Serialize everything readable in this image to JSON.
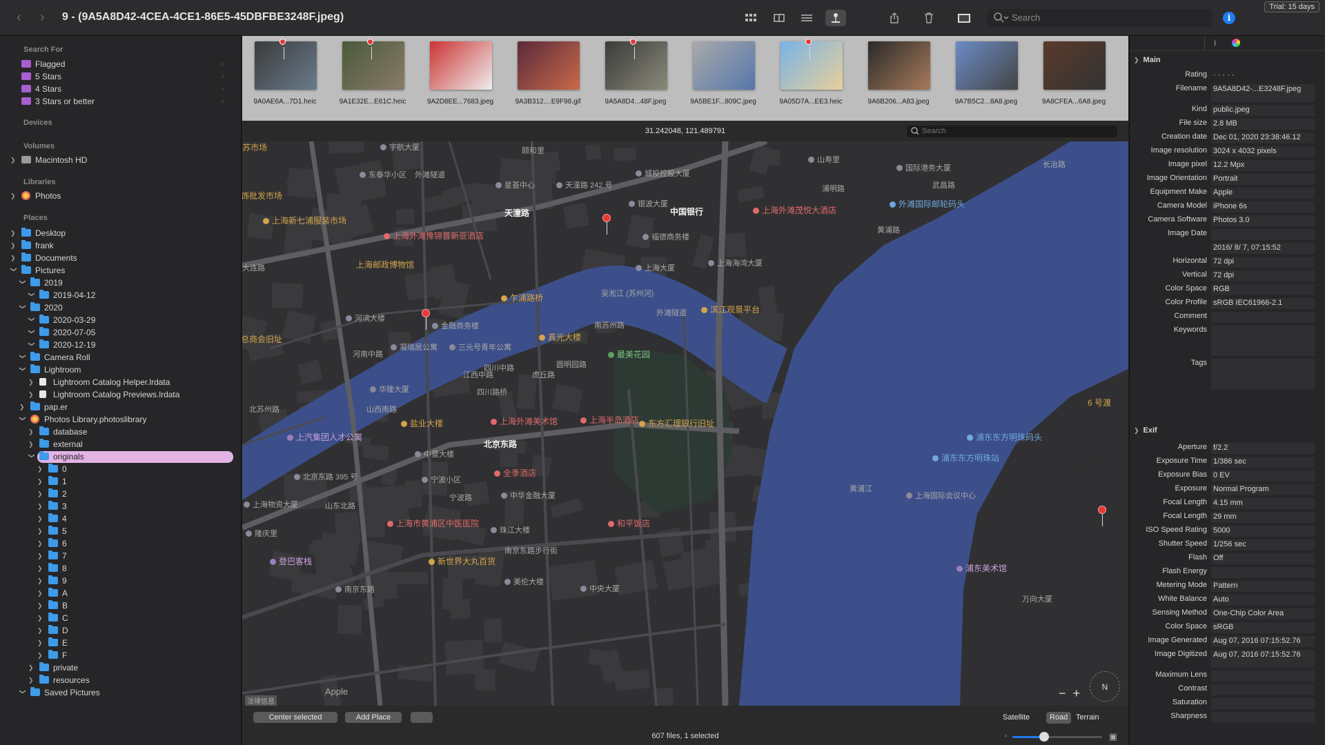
{
  "window": {
    "title": "9 - (9A5A8D42-4CEA-4CE1-86E5-45DBFBE3248F.jpeg)",
    "search_placeholder": "Search",
    "trial": "Trial: 15 days"
  },
  "sidebar": {
    "search_for": {
      "header": "Search For",
      "items": [
        "Flagged",
        "5 Stars",
        "4 Stars",
        "3 Stars or better"
      ]
    },
    "devices_header": "Devices",
    "volumes": {
      "header": "Volumes",
      "items": [
        "Macintosh HD"
      ]
    },
    "libraries": {
      "header": "Libraries",
      "items": [
        "Photos"
      ]
    },
    "places": {
      "header": "Places",
      "items": [
        {
          "label": "Desktop",
          "depth": 0,
          "open": false,
          "icon": "folder"
        },
        {
          "label": "frank",
          "depth": 0,
          "open": false,
          "icon": "folder"
        },
        {
          "label": "Documents",
          "depth": 0,
          "open": false,
          "icon": "folder"
        },
        {
          "label": "Pictures",
          "depth": 0,
          "open": true,
          "icon": "folder"
        },
        {
          "label": "2019",
          "depth": 1,
          "open": true,
          "icon": "folder"
        },
        {
          "label": "2019-04-12",
          "depth": 2,
          "open": true,
          "icon": "folder"
        },
        {
          "label": "2020",
          "depth": 1,
          "open": true,
          "icon": "folder"
        },
        {
          "label": "2020-03-29",
          "depth": 2,
          "open": true,
          "icon": "folder"
        },
        {
          "label": "2020-07-05",
          "depth": 2,
          "open": true,
          "icon": "folder"
        },
        {
          "label": "2020-12-19",
          "depth": 2,
          "open": true,
          "icon": "folder"
        },
        {
          "label": "Camera Roll",
          "depth": 1,
          "open": true,
          "icon": "folder"
        },
        {
          "label": "Lightroom",
          "depth": 1,
          "open": true,
          "icon": "folder"
        },
        {
          "label": "Lightroom Catalog Helper.lrdata",
          "depth": 2,
          "open": false,
          "icon": "document"
        },
        {
          "label": "Lightroom Catalog Previews.lrdata",
          "depth": 2,
          "open": false,
          "icon": "document"
        },
        {
          "label": "pap.er",
          "depth": 1,
          "open": false,
          "icon": "folder"
        },
        {
          "label": "Photos Library.photoslibrary",
          "depth": 1,
          "open": true,
          "icon": "photos"
        },
        {
          "label": "database",
          "depth": 2,
          "open": false,
          "icon": "folder"
        },
        {
          "label": "external",
          "depth": 2,
          "open": false,
          "icon": "folder"
        },
        {
          "label": "originals",
          "depth": 2,
          "open": true,
          "icon": "folder",
          "selected": true
        },
        {
          "label": "0",
          "depth": 3,
          "open": false,
          "icon": "folder"
        },
        {
          "label": "1",
          "depth": 3,
          "open": false,
          "icon": "folder"
        },
        {
          "label": "2",
          "depth": 3,
          "open": false,
          "icon": "folder"
        },
        {
          "label": "3",
          "depth": 3,
          "open": false,
          "icon": "folder"
        },
        {
          "label": "4",
          "depth": 3,
          "open": false,
          "icon": "folder"
        },
        {
          "label": "5",
          "depth": 3,
          "open": false,
          "icon": "folder"
        },
        {
          "label": "6",
          "depth": 3,
          "open": false,
          "icon": "folder"
        },
        {
          "label": "7",
          "depth": 3,
          "open": false,
          "icon": "folder"
        },
        {
          "label": "8",
          "depth": 3,
          "open": false,
          "icon": "folder"
        },
        {
          "label": "9",
          "depth": 3,
          "open": false,
          "icon": "folder"
        },
        {
          "label": "A",
          "depth": 3,
          "open": false,
          "icon": "folder"
        },
        {
          "label": "B",
          "depth": 3,
          "open": false,
          "icon": "folder"
        },
        {
          "label": "C",
          "depth": 3,
          "open": false,
          "icon": "folder"
        },
        {
          "label": "D",
          "depth": 3,
          "open": false,
          "icon": "folder"
        },
        {
          "label": "E",
          "depth": 3,
          "open": false,
          "icon": "folder"
        },
        {
          "label": "F",
          "depth": 3,
          "open": false,
          "icon": "folder"
        },
        {
          "label": "private",
          "depth": 2,
          "open": false,
          "icon": "folder"
        },
        {
          "label": "resources",
          "depth": 2,
          "open": false,
          "icon": "folder"
        },
        {
          "label": "Saved Pictures",
          "depth": 1,
          "open": true,
          "icon": "folder"
        }
      ]
    }
  },
  "filmstrip": [
    {
      "caption": "9A0AE6A...7D1.heic",
      "colors": [
        "#3b3b3b",
        "#6a7b8c"
      ],
      "pin": true
    },
    {
      "caption": "9A1E32E...E61C.heic",
      "colors": [
        "#4a5a3a",
        "#8a7a6a"
      ],
      "pin": true
    },
    {
      "caption": "9A2D8EE...7683.jpeg",
      "colors": [
        "#c33",
        "#eee"
      ],
      "pin": false
    },
    {
      "caption": "9A3B312....E9F98.gif",
      "colors": [
        "#5a2a3a",
        "#c86a4a"
      ],
      "pin": false
    },
    {
      "caption": "9A5A8D4...48F.jpeg",
      "colors": [
        "#3a3a3a",
        "#8a8a7a"
      ],
      "pin": true
    },
    {
      "caption": "9A5BE1F...809C.jpeg",
      "colors": [
        "#aaa",
        "#5577aa"
      ],
      "pin": false
    },
    {
      "caption": "9A05D7A...EE3.heic",
      "colors": [
        "#79b3e6",
        "#e8cf9a"
      ],
      "pin": true
    },
    {
      "caption": "9A6B206...A83.jpeg",
      "colors": [
        "#2a2a2a",
        "#a87a5a"
      ],
      "pin": false
    },
    {
      "caption": "9A7B5C2...8A8.jpeg",
      "colors": [
        "#6b8cc7",
        "#444"
      ],
      "pin": false
    },
    {
      "caption": "9A8CFEA...6A8.jpeg",
      "colors": [
        "#5a3a2a",
        "#333"
      ],
      "pin": false
    }
  ],
  "map": {
    "coords": "31.242048, 121.489791",
    "search_placeholder": "Search",
    "colors": {
      "land": "#303032",
      "water": "#3c4f8a",
      "park": "#2d3a33",
      "road": "#4a4a4e",
      "major_road": "#5e5e62",
      "block": "#3a3a3d"
    },
    "labels": [
      {
        "t": "宇航大厦",
        "c": "gr dot"
      },
      {
        "t": "颐和里",
        "c": "gr"
      },
      {
        "t": "东泰华小区",
        "c": "gr dot"
      },
      {
        "t": "星荟中心",
        "c": "gr dot"
      },
      {
        "t": "天潼路 242 号",
        "c": "gr dot"
      },
      {
        "t": "城投控股大厦",
        "c": "gr dot"
      },
      {
        "t": "山寿里",
        "c": "gr dot"
      },
      {
        "t": "国际港务大厦",
        "c": "gr dot"
      },
      {
        "t": "饰批发市场",
        "c": "y"
      },
      {
        "t": "上海新七浦服装市场",
        "c": "y dot"
      },
      {
        "t": "天潼路",
        "c": "w"
      },
      {
        "t": "上海外滩豫锦普新亚酒店",
        "c": "r dot"
      },
      {
        "t": "银波大厦",
        "c": "gr dot"
      },
      {
        "t": "中国银行",
        "c": "w"
      },
      {
        "t": "上海外滩茂悦大酒店",
        "c": "r dot"
      },
      {
        "t": "外滩国际邮轮码头",
        "c": "b dot"
      },
      {
        "t": "福德商务楼",
        "c": "gr dot"
      },
      {
        "t": "上海邮政博物馆",
        "c": "y"
      },
      {
        "t": "上海大厦",
        "c": "gr dot"
      },
      {
        "t": "上海海湾大厦",
        "c": "gr dot"
      },
      {
        "t": "乍浦路桥",
        "c": "y dot"
      },
      {
        "t": "吴淞江 (苏州河)",
        "c": "gr"
      },
      {
        "t": "滨江观景平台",
        "c": "y dot"
      },
      {
        "t": "河滨大楼",
        "c": "gr dot"
      },
      {
        "t": "金融商务楼",
        "c": "gr dot"
      },
      {
        "t": "南苏州路",
        "c": "gr"
      },
      {
        "t": "总商会旧址",
        "c": "y"
      },
      {
        "t": "凝瑞居公寓",
        "c": "gr dot"
      },
      {
        "t": "三元号青年公寓",
        "c": "gr dot"
      },
      {
        "t": "真光大楼",
        "c": "y dot"
      },
      {
        "t": "最美花园",
        "c": "g dot"
      },
      {
        "t": "华隆大厦",
        "c": "gr dot"
      },
      {
        "t": "河南中路",
        "c": "gr"
      },
      {
        "t": "四川中路",
        "c": "gr"
      },
      {
        "t": "虎丘路",
        "c": "gr"
      },
      {
        "t": "圆明园路",
        "c": "gr"
      },
      {
        "t": "外滩隧道",
        "c": "gr"
      },
      {
        "t": "上海外滩美术馆",
        "c": "r dot"
      },
      {
        "t": "上海半岛酒店",
        "c": "r dot"
      },
      {
        "t": "东方汇理银行旧址",
        "c": "y dot"
      },
      {
        "t": "盐业大楼",
        "c": "y dot"
      },
      {
        "t": "上汽集团人才公寓",
        "c": "p dot"
      },
      {
        "t": "北京东路",
        "c": "w"
      },
      {
        "t": "中垦大楼",
        "c": "gr dot"
      },
      {
        "t": "浦东东方明珠码头",
        "c": "b dot"
      },
      {
        "t": "浦东东方明珠站",
        "c": "b dot"
      },
      {
        "t": "6 号渡",
        "c": "y"
      },
      {
        "t": "北京东路 395 号",
        "c": "gr dot"
      },
      {
        "t": "宁波小区",
        "c": "gr dot"
      },
      {
        "t": "全季酒店",
        "c": "r dot"
      },
      {
        "t": "中华金融大厦",
        "c": "gr dot"
      },
      {
        "t": "上海国际会议中心",
        "c": "gr dot"
      },
      {
        "t": "上海物资大厦",
        "c": "gr dot"
      },
      {
        "t": "宁波路",
        "c": "gr"
      },
      {
        "t": "上海市黄浦区中医医院",
        "c": "r dot"
      },
      {
        "t": "和平饭店",
        "c": "r dot"
      },
      {
        "t": "隆庆里",
        "c": "gr dot"
      },
      {
        "t": "珠江大楼",
        "c": "gr dot"
      },
      {
        "t": "登巴客栈",
        "c": "p dot"
      },
      {
        "t": "新世界大丸百货",
        "c": "y dot"
      },
      {
        "t": "南京东路步行街",
        "c": "gr"
      },
      {
        "t": "美伦大楼",
        "c": "gr dot"
      },
      {
        "t": "中央大厦",
        "c": "gr dot"
      },
      {
        "t": "浦东美术馆",
        "c": "p dot"
      },
      {
        "t": "黄浦江",
        "c": "gr"
      },
      {
        "t": "南京东路",
        "c": "gr dot"
      },
      {
        "t": "万向大厦",
        "c": "gr"
      },
      {
        "t": "北苏州路",
        "c": "gr"
      },
      {
        "t": "山东北路",
        "c": "gr"
      },
      {
        "t": "江西中路",
        "c": "gr"
      },
      {
        "t": "四川路桥",
        "c": "gr"
      },
      {
        "t": "山西南路",
        "c": "gr"
      },
      {
        "t": "外滩隧道",
        "c": "gr"
      },
      {
        "t": "浦明路",
        "c": "gr"
      },
      {
        "t": "黄浦路",
        "c": "gr"
      },
      {
        "t": "武昌路",
        "c": "gr"
      },
      {
        "t": "长治路",
        "c": "gr"
      },
      {
        "t": "大连路",
        "c": "gr"
      },
      {
        "t": "苏市场",
        "c": "y"
      }
    ],
    "apple_maps": "Apple",
    "legal": "法律信息",
    "compass": "N"
  },
  "bottombar": {
    "center_selected": "Center selected",
    "add_place": "Add Place",
    "map_types": [
      "Satellite",
      "Road",
      "Terrain"
    ],
    "active_map_type": "Road",
    "status": "607 files, 1 selected",
    "zoom": 0.35
  },
  "inspector": {
    "main": {
      "header": "Main",
      "fields": [
        {
          "k": "Rating",
          "v": "· · · · ·",
          "blank": true
        },
        {
          "k": "Filename",
          "v": "9A5A8D42-...E3248F.jpeg",
          "tall": true
        },
        {
          "k": "Kind",
          "v": "public.jpeg"
        },
        {
          "k": "File size",
          "v": "2.8 MB"
        },
        {
          "k": "Creation date",
          "v": "Dec 01, 2020 23:38:46.12"
        },
        {
          "k": "Image resolution",
          "v": "3024 x 4032 pixels"
        },
        {
          "k": "Image pixel",
          "v": "12.2 Mpx"
        },
        {
          "k": "Image Orientation",
          "v": "Portrait"
        },
        {
          "k": "Equipment Make",
          "v": "Apple"
        },
        {
          "k": "Camera Model",
          "v": "iPhone 6s"
        },
        {
          "k": "Camera Software",
          "v": "Photos 3.0"
        },
        {
          "k": "Image Date",
          "v": ""
        },
        {
          "k": "",
          "v": "2016/ 8/ 7, 07:15:52"
        },
        {
          "k": "Horizontal",
          "v": "72 dpi"
        },
        {
          "k": "Vertical",
          "v": "72 dpi"
        },
        {
          "k": "Color Space",
          "v": "RGB"
        },
        {
          "k": "Color Profile",
          "v": "sRGB IEC61966-2.1"
        },
        {
          "k": "Comment",
          "v": ""
        },
        {
          "k": "Keywords",
          "v": "",
          "tall": true
        },
        {
          "k": "Tags",
          "v": "",
          "tall": true
        }
      ]
    },
    "exif": {
      "header": "Exif",
      "fields": [
        {
          "k": "Aperture",
          "v": "f/2.2"
        },
        {
          "k": "Exposure Time",
          "v": "1/386 sec"
        },
        {
          "k": "Exposure Bias",
          "v": "0 EV"
        },
        {
          "k": "Exposure",
          "v": "Normal Program"
        },
        {
          "k": "Focal Length",
          "v": "4.15 mm"
        },
        {
          "k": "Focal Length",
          "v": "29 mm"
        },
        {
          "k": "ISO Speed Rating",
          "v": "5000"
        },
        {
          "k": "Shutter Speed",
          "v": "1/256 sec"
        },
        {
          "k": "Flash",
          "v": "Off"
        },
        {
          "k": "Flash Energy",
          "v": ""
        },
        {
          "k": "Metering Mode",
          "v": "Pattern"
        },
        {
          "k": "White Balance",
          "v": "Auto"
        },
        {
          "k": "Sensing Method",
          "v": "One-Chip Color Area"
        },
        {
          "k": "Color Space",
          "v": "sRGB"
        },
        {
          "k": "Image Generated",
          "v": "Aug 07, 2016 07:15:52.76"
        },
        {
          "k": "Image Digitized",
          "v": "Aug 07, 2016 07:15:52.76",
          "tall": true
        },
        {
          "k": "Maximum Lens",
          "v": ""
        },
        {
          "k": "Contrast",
          "v": ""
        },
        {
          "k": "Saturation",
          "v": ""
        },
        {
          "k": "Sharpness",
          "v": ""
        }
      ]
    }
  }
}
